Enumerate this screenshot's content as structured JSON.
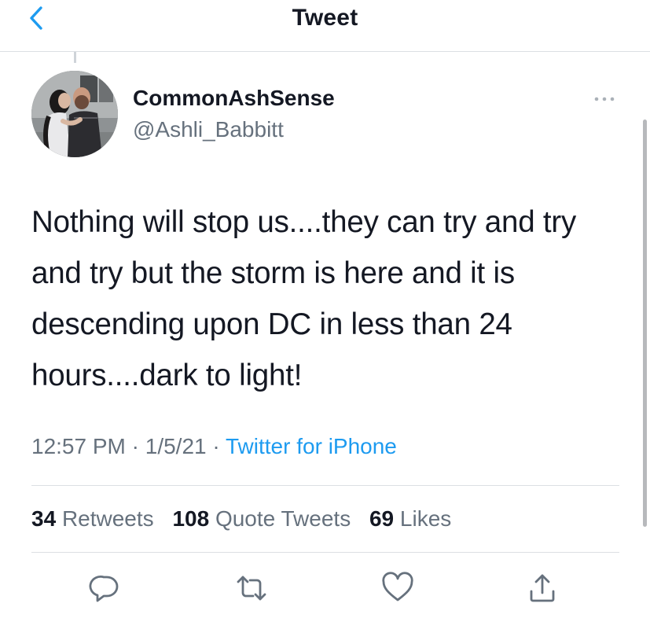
{
  "header": {
    "title": "Tweet",
    "back_icon": "chevron-left-icon"
  },
  "tweet": {
    "author": {
      "display_name": "CommonAshSense",
      "handle": "@Ashli_Babbitt"
    },
    "text": "Nothing will stop us....they can try and try and try but the storm is here and it is descending upon DC in less than 24 hours....dark to light!",
    "time": "12:57 PM",
    "date": "1/5/21",
    "separator": "·",
    "source": "Twitter for iPhone",
    "stats": {
      "retweets_count": "34",
      "retweets_label": "Retweets",
      "quotes_count": "108",
      "quotes_label": "Quote Tweets",
      "likes_count": "69",
      "likes_label": "Likes"
    }
  },
  "actions": [
    "reply-icon",
    "retweet-icon",
    "like-icon",
    "share-icon"
  ],
  "colors": {
    "accent": "#1d9bf0",
    "text": "#141823",
    "secondary": "#66717d",
    "divider": "#dcdfe3"
  }
}
